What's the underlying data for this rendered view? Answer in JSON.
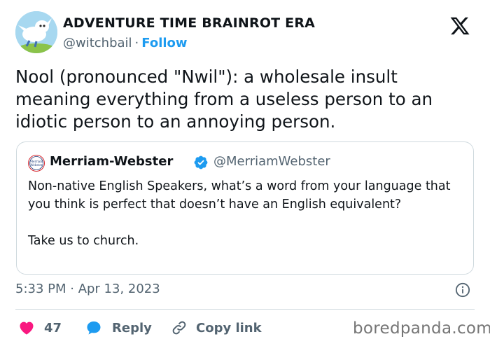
{
  "author": {
    "display_name": "ADVENTURE TIME BRAINROT ERA",
    "handle": "@witchbail",
    "separator": "·",
    "follow_label": "Follow"
  },
  "tweet": {
    "text": "Nool (pronounced \"Nwil\"): a wholesale insult meaning everything from a useless person to an idiotic person to an annoying person.",
    "timestamp": "5:33 PM · Apr 13, 2023"
  },
  "quoted_tweet": {
    "display_name": "Merriam-Webster",
    "handle": "@MerriamWebster",
    "logo_text": [
      "Merriam",
      "Webster"
    ],
    "paragraphs": [
      "Non-native English Speakers, what’s a word from your language that you think is perfect that doesn’t have an English equivalent?",
      "Take us to church."
    ]
  },
  "actions": {
    "like_count": "47",
    "reply_label": "Reply",
    "copy_link_label": "Copy link"
  },
  "icons": {
    "logo": "x-logo-icon",
    "verified": "verified-badge-icon",
    "info": "info-icon",
    "like": "heart-icon",
    "reply": "speech-bubble-icon",
    "copy": "link-icon"
  },
  "watermark": "boredpanda.com",
  "colors": {
    "text": "#0f1419",
    "secondary": "#536471",
    "accent": "#1d9bf0",
    "like": "#f91880",
    "border": "#cfd9de"
  }
}
